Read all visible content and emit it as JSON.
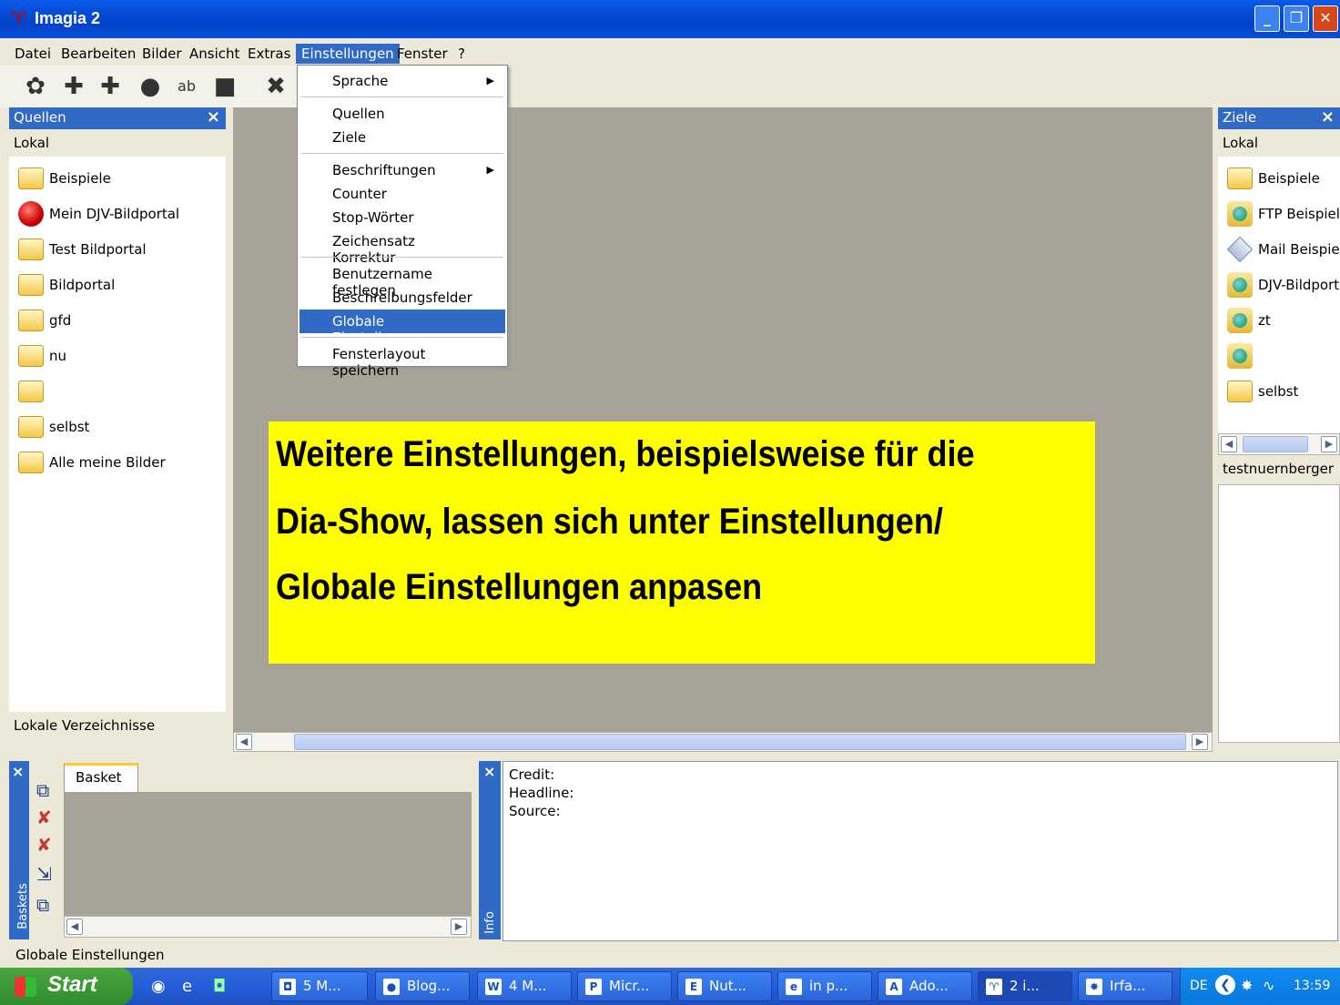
{
  "window": {
    "title": "Imagia 2",
    "minimize": "_",
    "restore": "❐",
    "close": "✕"
  },
  "menubar": [
    {
      "label": "Datei"
    },
    {
      "label": "Bearbeiten"
    },
    {
      "label": "Bilder"
    },
    {
      "label": "Ansicht"
    },
    {
      "label": "Extras"
    },
    {
      "label": "Einstellungen"
    },
    {
      "label": "Fenster"
    },
    {
      "label": "?"
    }
  ],
  "dropdown": {
    "items": [
      {
        "label": "Sprache"
      },
      {
        "label": "Quellen"
      },
      {
        "label": "Ziele"
      },
      {
        "label": "Beschriftungen"
      },
      {
        "label": "Counter"
      },
      {
        "label": "Stop-Wörter"
      },
      {
        "label": "Zeichensatz Korrektur"
      },
      {
        "label": "Benutzername festlegen"
      },
      {
        "label": "Beschreibungsfelder"
      },
      {
        "label": "Globale Einstellungen"
      },
      {
        "label": "Fensterlayout speichern"
      }
    ]
  },
  "quellen": {
    "title": "Quellen",
    "sub": "Lokal",
    "items": [
      "Beispiele",
      "Mein DJV-Bildportal",
      "Test Bildportal",
      "Bildportal",
      "gfd",
      "nu",
      "",
      "selbst",
      "Alle meine Bilder"
    ],
    "footer": "Lokale Verzeichnisse"
  },
  "ziele": {
    "title": "Ziele",
    "sub": "Lokal",
    "items": [
      "Beispiele",
      "FTP Beispiel",
      "Mail Beispiel",
      "DJV-Bildportal",
      "zt",
      "",
      "selbst"
    ],
    "footer": "testnuernberger"
  },
  "callout": {
    "line1": "Weitere Einstellungen, beispielsweise für die",
    "line2": "Dia-Show, lassen sich unter Einstellungen/",
    "line3": "Globale Einstellungen anpasen"
  },
  "basket": {
    "tab": "Basket",
    "side": "Baskets"
  },
  "info": {
    "credit": "Credit:",
    "headline": "Headline:",
    "source": "Source:",
    "side": "Info"
  },
  "status": "Globale Einstellungen",
  "taskbar": {
    "start": "Start",
    "tasks": [
      "5 M...",
      "Blog...",
      "4 M...",
      "Micr...",
      "Nut...",
      "in p...",
      "Ado...",
      "2 i...",
      "Irfa..."
    ],
    "lang": "DE",
    "time": "13:59"
  }
}
